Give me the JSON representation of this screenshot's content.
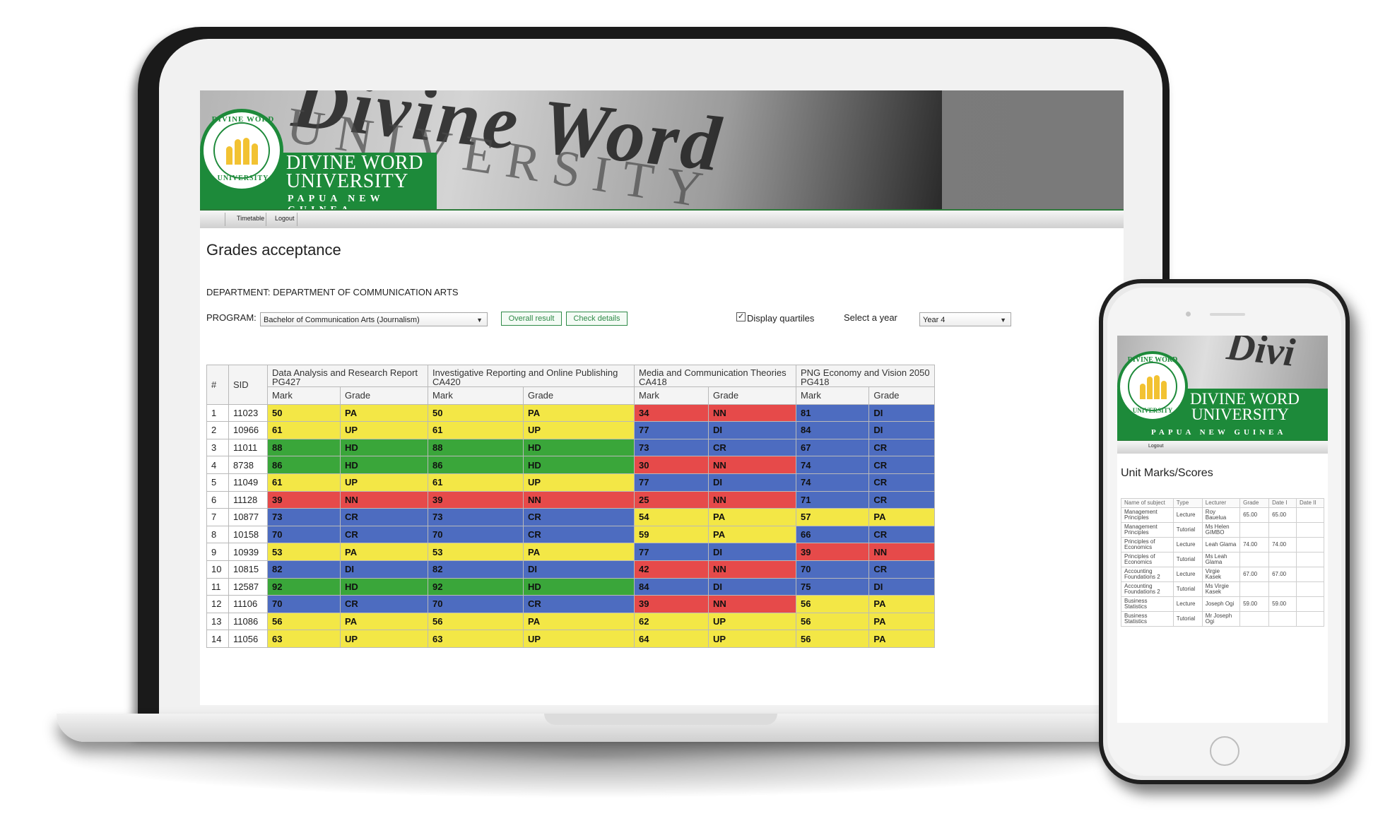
{
  "desktop": {
    "brand": {
      "name_line1": "DIVINE WORD",
      "name_line2": "UNIVERSITY",
      "subtitle": "PAPUA NEW GUINEA",
      "seal_top": "DIVINE WORD",
      "seal_bottom": "UNIVERSITY",
      "watermark": "Divine Word",
      "watermark2": "UNIVERSITY"
    },
    "nav": {
      "timetable": "Timetable",
      "logout": "Logout"
    },
    "page_title": "Grades acceptance",
    "department": "DEPARTMENT: DEPARTMENT OF COMMUNICATION ARTS",
    "program_label": "PROGRAM:",
    "program_value": "Bachelor of Communication Arts (Journalism)",
    "buttons": {
      "overall": "Overall result",
      "check": "Check details"
    },
    "display_quartiles_label": "Display quartiles",
    "display_quartiles_checked": "✓",
    "year_label": "Select a year",
    "year_value": "Year 4",
    "table": {
      "idx_header": "#",
      "sid_header": "SID",
      "mark_header": "Mark",
      "grade_header": "Grade",
      "subjects": [
        {
          "name": "Data Analysis and Research Report",
          "code": "PG427"
        },
        {
          "name": "Investigative Reporting and Online Publishing",
          "code": "CA420"
        },
        {
          "name": "Media and Communication Theories",
          "code": "CA418"
        },
        {
          "name": "PNG Economy and Vision 2050",
          "code": "PG418"
        }
      ],
      "rows": [
        {
          "idx": "1",
          "sid": "11023",
          "cells": [
            [
              "50",
              "PA"
            ],
            [
              "50",
              "PA"
            ],
            [
              "34",
              "NN"
            ],
            [
              "81",
              "DI"
            ]
          ]
        },
        {
          "idx": "2",
          "sid": "10966",
          "cells": [
            [
              "61",
              "UP"
            ],
            [
              "61",
              "UP"
            ],
            [
              "77",
              "DI"
            ],
            [
              "84",
              "DI"
            ]
          ]
        },
        {
          "idx": "3",
          "sid": "11011",
          "cells": [
            [
              "88",
              "HD"
            ],
            [
              "88",
              "HD"
            ],
            [
              "73",
              "CR"
            ],
            [
              "67",
              "CR"
            ]
          ]
        },
        {
          "idx": "4",
          "sid": "8738",
          "cells": [
            [
              "86",
              "HD"
            ],
            [
              "86",
              "HD"
            ],
            [
              "30",
              "NN"
            ],
            [
              "74",
              "CR"
            ]
          ]
        },
        {
          "idx": "5",
          "sid": "11049",
          "cells": [
            [
              "61",
              "UP"
            ],
            [
              "61",
              "UP"
            ],
            [
              "77",
              "DI"
            ],
            [
              "74",
              "CR"
            ]
          ]
        },
        {
          "idx": "6",
          "sid": "11128",
          "cells": [
            [
              "39",
              "NN"
            ],
            [
              "39",
              "NN"
            ],
            [
              "25",
              "NN"
            ],
            [
              "71",
              "CR"
            ]
          ]
        },
        {
          "idx": "7",
          "sid": "10877",
          "cells": [
            [
              "73",
              "CR"
            ],
            [
              "73",
              "CR"
            ],
            [
              "54",
              "PA"
            ],
            [
              "57",
              "PA"
            ]
          ]
        },
        {
          "idx": "8",
          "sid": "10158",
          "cells": [
            [
              "70",
              "CR"
            ],
            [
              "70",
              "CR"
            ],
            [
              "59",
              "PA"
            ],
            [
              "66",
              "CR"
            ]
          ]
        },
        {
          "idx": "9",
          "sid": "10939",
          "cells": [
            [
              "53",
              "PA"
            ],
            [
              "53",
              "PA"
            ],
            [
              "77",
              "DI"
            ],
            [
              "39",
              "NN"
            ]
          ]
        },
        {
          "idx": "10",
          "sid": "10815",
          "cells": [
            [
              "82",
              "DI"
            ],
            [
              "82",
              "DI"
            ],
            [
              "42",
              "NN"
            ],
            [
              "70",
              "CR"
            ]
          ]
        },
        {
          "idx": "11",
          "sid": "12587",
          "cells": [
            [
              "92",
              "HD"
            ],
            [
              "92",
              "HD"
            ],
            [
              "84",
              "DI"
            ],
            [
              "75",
              "DI"
            ]
          ]
        },
        {
          "idx": "12",
          "sid": "11106",
          "cells": [
            [
              "70",
              "CR"
            ],
            [
              "70",
              "CR"
            ],
            [
              "39",
              "NN"
            ],
            [
              "56",
              "PA"
            ]
          ]
        },
        {
          "idx": "13",
          "sid": "11086",
          "cells": [
            [
              "56",
              "PA"
            ],
            [
              "56",
              "PA"
            ],
            [
              "62",
              "UP"
            ],
            [
              "56",
              "PA"
            ]
          ]
        },
        {
          "idx": "14",
          "sid": "11056",
          "cells": [
            [
              "63",
              "UP"
            ],
            [
              "63",
              "UP"
            ],
            [
              "64",
              "UP"
            ],
            [
              "56",
              "PA"
            ]
          ]
        }
      ]
    },
    "grade_colors": {
      "HD": "#3aa63a",
      "DI": "#4d6cc0",
      "CR": "#4d6cc0",
      "UP": "#f3e746",
      "PA": "#f3e746",
      "NN": "#e64a4a"
    }
  },
  "mobile": {
    "brand": {
      "name_line1": "DIVINE WORD",
      "name_line2": "UNIVERSITY",
      "subtitle": "PAPUA NEW GUINEA",
      "seal_top": "DIVINE WORD",
      "seal_bottom": "UNIVERSITY",
      "watermark": "Divi"
    },
    "nav": {
      "logout": "Logout"
    },
    "title": "Unit Marks/Scores",
    "table": {
      "headers": [
        "Name of subject",
        "Type",
        "Lecturer",
        "Grade",
        "Date I",
        "Date II"
      ],
      "rows": [
        [
          "Management Principles",
          "Lecture",
          "Roy Bauelua",
          "65.00",
          "65.00",
          ""
        ],
        [
          "Management Principles",
          "Tutorial",
          "Ms Helen GIMBO",
          "",
          "",
          ""
        ],
        [
          "Principles of Economics",
          "Lecture",
          "Leah Glama",
          "74.00",
          "74.00",
          ""
        ],
        [
          "Principles of Economics",
          "Tutorial",
          "Ms Leah Glama",
          "",
          "",
          ""
        ],
        [
          "Accounting Foundations 2",
          "Lecture",
          "Virgie Kasek",
          "67.00",
          "67.00",
          ""
        ],
        [
          "Accounting Foundations 2",
          "Tutorial",
          "Ms Virgie Kasek",
          "",
          "",
          ""
        ],
        [
          "Business Statistics",
          "Lecture",
          "Joseph Ogi",
          "59.00",
          "59.00",
          ""
        ],
        [
          "Business Statistics",
          "Tutorial",
          "Mr Joseph Ogi",
          "",
          "",
          ""
        ]
      ]
    }
  }
}
